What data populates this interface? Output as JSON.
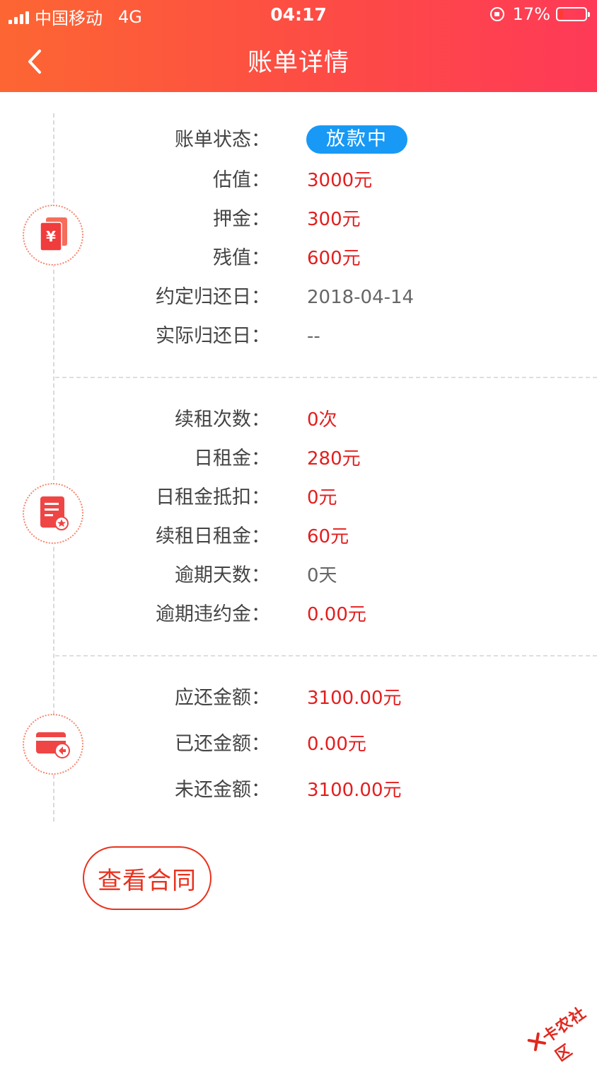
{
  "status_bar": {
    "carrier": "中国移动",
    "network": "4G",
    "time": "04:17",
    "battery": "17%"
  },
  "header": {
    "title": "账单详情",
    "back_icon": "chevron-left-icon"
  },
  "section1": {
    "icon": "money-documents-icon",
    "rows": [
      {
        "label": "账单状态",
        "value": "放款中",
        "style": "pill"
      },
      {
        "label": "估值",
        "value": "3000元",
        "style": "red"
      },
      {
        "label": "押金",
        "value": "300元",
        "style": "red"
      },
      {
        "label": "残值",
        "value": "600元",
        "style": "red"
      },
      {
        "label": "约定归还日",
        "value": "2018-04-14",
        "style": "gray"
      },
      {
        "label": "实际归还日",
        "value": "--",
        "style": "gray"
      }
    ]
  },
  "section2": {
    "icon": "bill-document-icon",
    "rows": [
      {
        "label": "续租次数",
        "value": "0次",
        "style": "red"
      },
      {
        "label": "日租金",
        "value": "280元",
        "style": "red"
      },
      {
        "label": "日租金抵扣",
        "value": "0元",
        "style": "red"
      },
      {
        "label": "续租日租金",
        "value": "60元",
        "style": "red"
      },
      {
        "label": "逾期天数",
        "value": "0天",
        "style": "gray"
      },
      {
        "label": "逾期违约金",
        "value": "0.00元",
        "style": "red"
      }
    ]
  },
  "section3": {
    "icon": "card-repay-icon",
    "rows": [
      {
        "label": "应还金额",
        "value": "3100.00元",
        "style": "red"
      },
      {
        "label": "已还金额",
        "value": "0.00元",
        "style": "red"
      },
      {
        "label": "未还金额",
        "value": "3100.00元",
        "style": "red"
      }
    ]
  },
  "contract_button": {
    "label": "查看合同"
  },
  "watermark": {
    "text": "卡农社区"
  },
  "colors": {
    "header_start": "#fd6633",
    "header_end": "#fe3a57",
    "accent_red": "#e41e1e",
    "pill_blue": "#1899f5"
  }
}
